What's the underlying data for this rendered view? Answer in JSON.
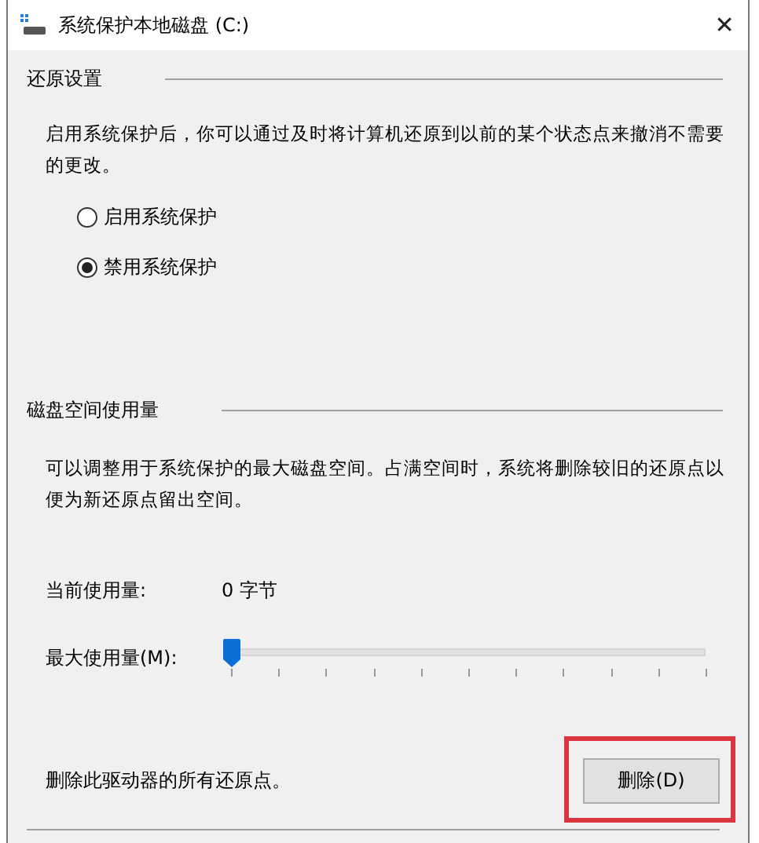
{
  "window": {
    "title": "系统保护本地磁盘 (C:)",
    "close": "✕"
  },
  "restore_settings": {
    "heading": "还原设置",
    "description": "启用系统保护后，你可以通过及时将计算机还原到以前的某个状态点来撤消不需要的更改。",
    "options": [
      {
        "label": "启用系统保护",
        "selected": false
      },
      {
        "label": "禁用系统保护",
        "selected": true
      }
    ]
  },
  "disk_usage": {
    "heading": "磁盘空间使用量",
    "description": "可以调整用于系统保护的最大磁盘空间。占满空间时，系统将删除较旧的还原点以便为新还原点留出空间。",
    "current_label": "当前使用量:",
    "current_value": "0 字节",
    "max_label": "最大使用量(M):",
    "max_slider": {
      "level": 0
    }
  },
  "delete": {
    "description": "删除此驱动器的所有还原点。",
    "button": "删除(D)",
    "highlighted": true
  }
}
